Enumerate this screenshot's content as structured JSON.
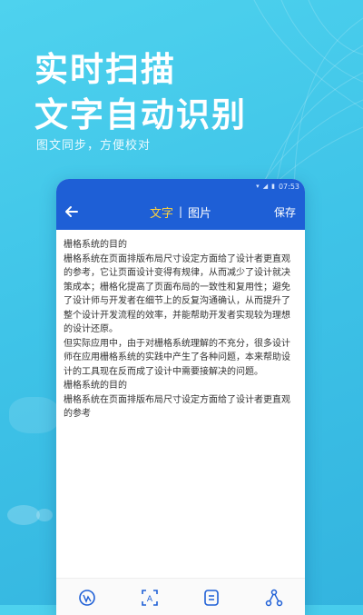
{
  "promo": {
    "headline_line1": "实时扫描",
    "headline_line2": "文字自动识别",
    "subtitle": "图文同步，方便校对"
  },
  "statusbar": {
    "time": "07:53"
  },
  "appbar": {
    "tab_text": "文字",
    "tab_separator": "|",
    "tab_image": "图片",
    "save_label": "保存",
    "active_tab_color": "#ffd23c",
    "bar_color": "#1e5fd6"
  },
  "document": {
    "text": "栅格系统的目的\n栅格系统在页面排版布局尺寸设定方面给了设计者更直观的参考，它让页面设计变得有规律，从而减少了设计就决策成本；栅格化提高了页面布局的一致性和复用性；避免了设计师与开发者在细节上的反复沟通确认，从而提升了整个设计开发流程的效率，并能帮助开发者实现较为理想的设计还原。\n但实际应用中，由于对栅格系统理解的不充分，很多设计师在应用栅格系统的实践中产生了各种问题，本来帮助设计的工具现在反而成了设计中需要接解决的问题。\n栅格系统的目的\n栅格系统在页面排版布局尺寸设定方面给了设计者更直观的参考"
  },
  "bottom_nav": {
    "icons": [
      "translate-icon",
      "scan-text-icon",
      "document-icon",
      "share-icon"
    ]
  }
}
